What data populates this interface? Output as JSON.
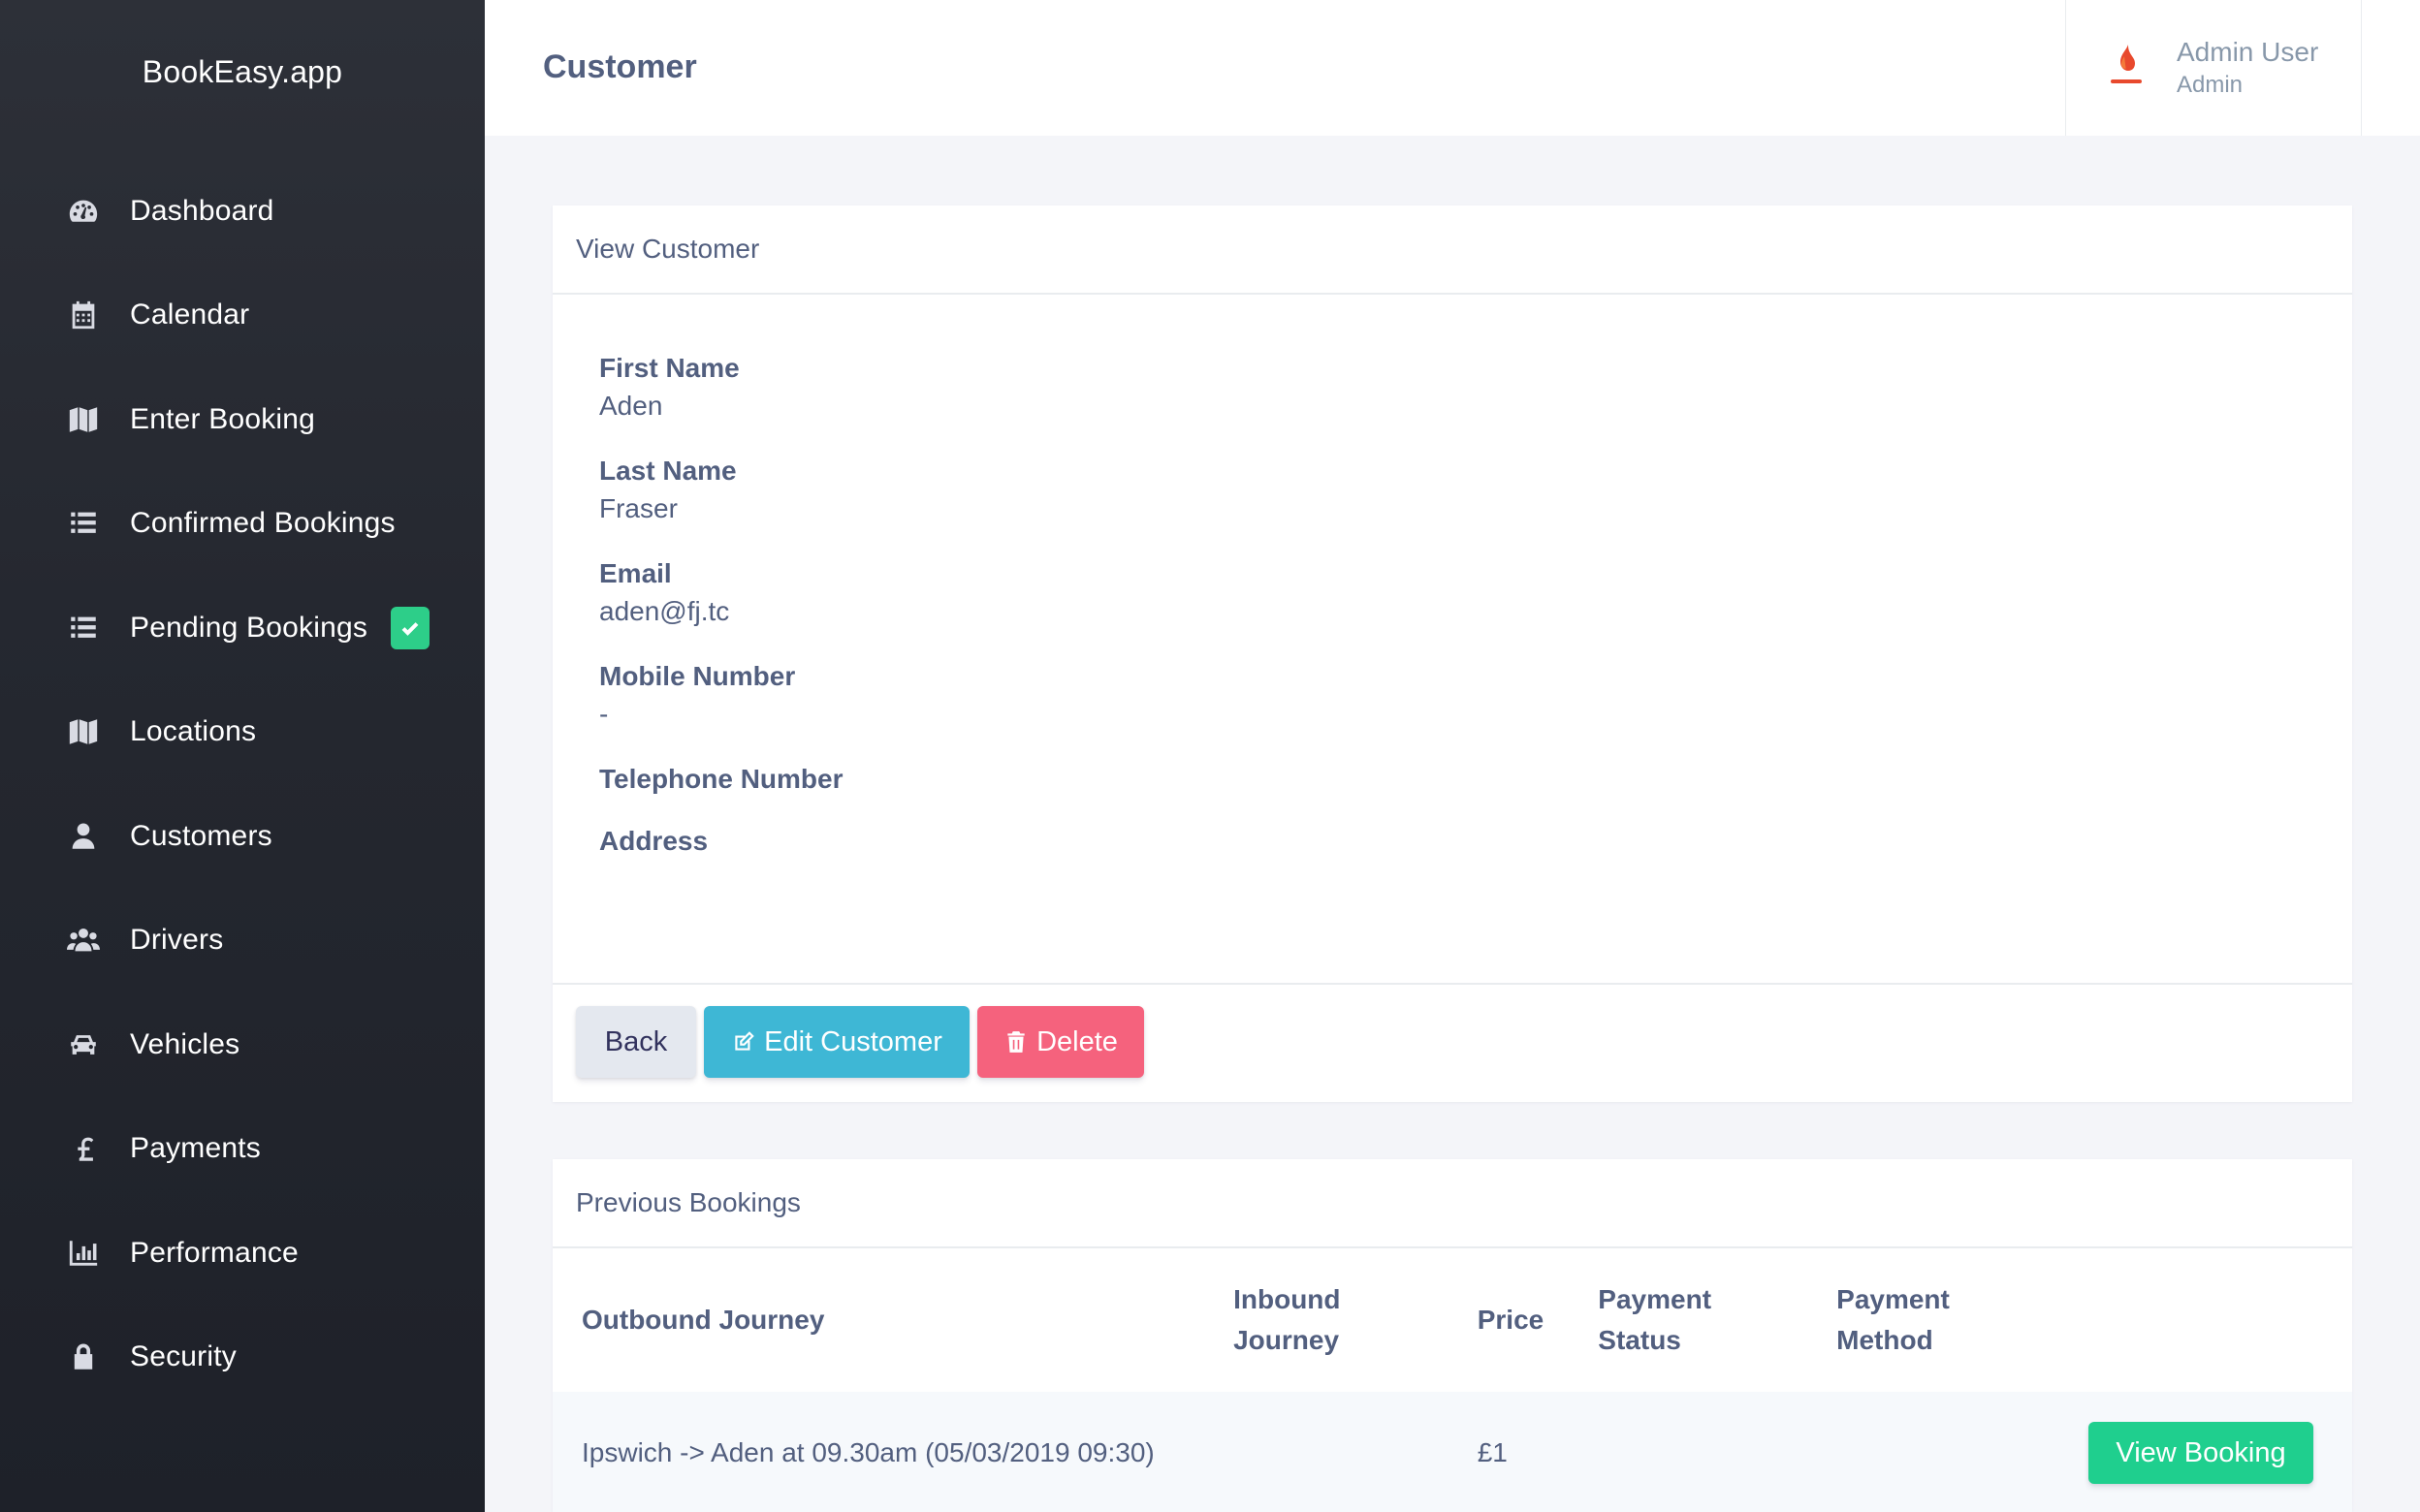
{
  "app": {
    "brand": "BookEasy.app"
  },
  "sidebar": {
    "items": [
      {
        "label": "Dashboard",
        "icon": "dashboard-icon"
      },
      {
        "label": "Calendar",
        "icon": "calendar-icon"
      },
      {
        "label": "Enter Booking",
        "icon": "map-icon"
      },
      {
        "label": "Confirmed Bookings",
        "icon": "list-icon"
      },
      {
        "label": "Pending Bookings",
        "icon": "list-icon",
        "badge": "check-icon"
      },
      {
        "label": "Locations",
        "icon": "map-icon"
      },
      {
        "label": "Customers",
        "icon": "user-icon"
      },
      {
        "label": "Drivers",
        "icon": "users-icon"
      },
      {
        "label": "Vehicles",
        "icon": "car-icon"
      },
      {
        "label": "Payments",
        "icon": "pound-icon"
      },
      {
        "label": "Performance",
        "icon": "bar-chart-icon"
      },
      {
        "label": "Security",
        "icon": "lock-icon"
      }
    ]
  },
  "header": {
    "title": "Customer",
    "user": {
      "name": "Admin User",
      "role": "Admin"
    }
  },
  "customer_card": {
    "title": "View Customer",
    "fields": [
      {
        "label": "First Name",
        "value": "Aden"
      },
      {
        "label": "Last Name",
        "value": "Fraser"
      },
      {
        "label": "Email",
        "value": "aden@fj.tc"
      },
      {
        "label": "Mobile Number",
        "value": "-"
      },
      {
        "label": "Telephone Number",
        "value": ""
      },
      {
        "label": "Address",
        "value": ""
      }
    ],
    "buttons": {
      "back": "Back",
      "edit": "Edit Customer",
      "delete": "Delete"
    }
  },
  "bookings_card": {
    "title": "Previous Bookings",
    "columns": [
      "Outbound Journey",
      "Inbound Journey",
      "Price",
      "Payment Status",
      "Payment Method"
    ],
    "rows": [
      {
        "outbound": "Ipswich -> Aden at 09.30am (05/03/2019 09:30)",
        "inbound": "",
        "price": "£1",
        "payment_status": "",
        "payment_method": "",
        "action": "View Booking"
      }
    ]
  },
  "colors": {
    "sidebar_bg": "#252830",
    "accent_green": "#2dce89",
    "edit_blue": "#3eb7d5",
    "delete_red": "#f5627d",
    "page_bg": "#f4f5f9"
  }
}
